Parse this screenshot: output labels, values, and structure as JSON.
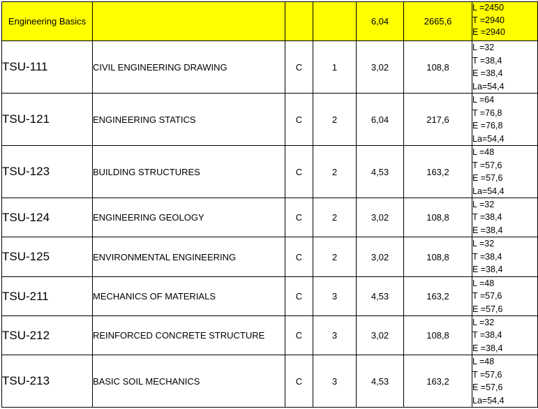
{
  "table": {
    "header": {
      "section_title": "Engineering Basics",
      "credits": "6,04",
      "hours": "2665,6",
      "breakdown": [
        "L =2450",
        "T =2940",
        "E =2940"
      ]
    },
    "rows": [
      {
        "code": "TSU-111",
        "name": "CIVIL ENGINEERING DRAWING",
        "type": "C",
        "semester": "1",
        "credits": "3,02",
        "hours": "108,8",
        "breakdown": [
          "L =32",
          "T =38,4",
          "E =38,4",
          "La=54,4"
        ]
      },
      {
        "code": "TSU-121",
        "name": "ENGINEERING STATICS",
        "type": "C",
        "semester": "2",
        "credits": "6,04",
        "hours": "217,6",
        "breakdown": [
          "L =64",
          "T =76,8",
          "E =76,8",
          "La=54,4"
        ]
      },
      {
        "code": "TSU-123",
        "name": "BUILDING STRUCTURES",
        "type": "C",
        "semester": "2",
        "credits": "4,53",
        "hours": "163,2",
        "breakdown": [
          "L =48",
          "T =57,6",
          "E =57,6",
          "La=54,4"
        ]
      },
      {
        "code": "TSU-124",
        "name": "ENGINEERING GEOLOGY",
        "type": "C",
        "semester": "2",
        "credits": "3,02",
        "hours": "108,8",
        "breakdown": [
          "L =32",
          "T =38,4",
          "E =38,4"
        ]
      },
      {
        "code": "TSU-125",
        "name": "ENVIRONMENTAL ENGINEERING",
        "type": "C",
        "semester": "2",
        "credits": "3,02",
        "hours": "108,8",
        "breakdown": [
          "L =32",
          "T =38,4",
          "E =38,4"
        ]
      },
      {
        "code": "TSU-211",
        "name": "MECHANICS OF MATERIALS",
        "type": "C",
        "semester": "3",
        "credits": "4,53",
        "hours": "163,2",
        "breakdown": [
          "L =48",
          "T =57,6",
          "E =57,6"
        ]
      },
      {
        "code": "TSU-212",
        "name": "REINFORCED CONCRETE STRUCTURE",
        "type": "C",
        "semester": "3",
        "credits": "3,02",
        "hours": "108,8",
        "breakdown": [
          "L =32",
          "T =38,4",
          "E =38,4"
        ]
      },
      {
        "code": "TSU-213",
        "name": "BASIC SOIL MECHANICS",
        "type": "C",
        "semester": "3",
        "credits": "4,53",
        "hours": "163,2",
        "breakdown": [
          "L =48",
          "T =57,6",
          "E =57,6",
          "La=54,4"
        ]
      }
    ]
  },
  "colors": {
    "header_background": "#ffff00",
    "grid_lines": "#000000"
  }
}
